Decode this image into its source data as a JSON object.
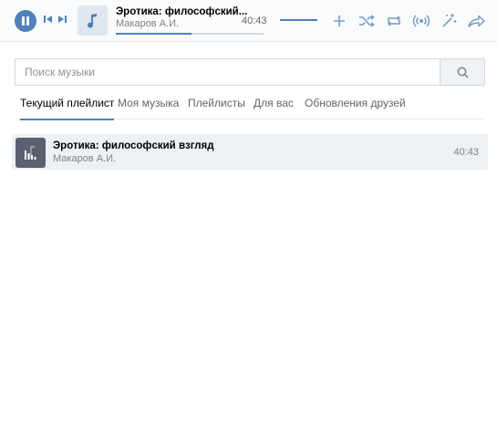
{
  "player": {
    "title": "Эротика: философский...",
    "artist": "Макаров А.И.",
    "time": "40:43",
    "progress": 0.51,
    "volume": 1.0,
    "icons": [
      "pause-icon",
      "previous-icon",
      "next-icon",
      "music-note-icon",
      "add-icon",
      "shuffle-icon",
      "repeat-icon",
      "broadcast-icon",
      "recommendations-icon",
      "share-icon"
    ]
  },
  "search": {
    "placeholder": "Поиск музыки",
    "value": ""
  },
  "tabs": [
    {
      "label": "Текущий плейлист",
      "active": true
    },
    {
      "label": "Моя музыка",
      "active": false
    },
    {
      "label": "Плейлисты",
      "active": false
    },
    {
      "label": "Для вас",
      "active": false
    },
    {
      "label": "Обновления друзей",
      "active": false
    }
  ],
  "tracks": [
    {
      "title": "Эротика: философский взгляд",
      "artist": "Макаров А.И.",
      "duration": "40:43",
      "playing": true
    }
  ],
  "colors": {
    "accent": "#5181b8",
    "row_active": "#edf0f5"
  }
}
